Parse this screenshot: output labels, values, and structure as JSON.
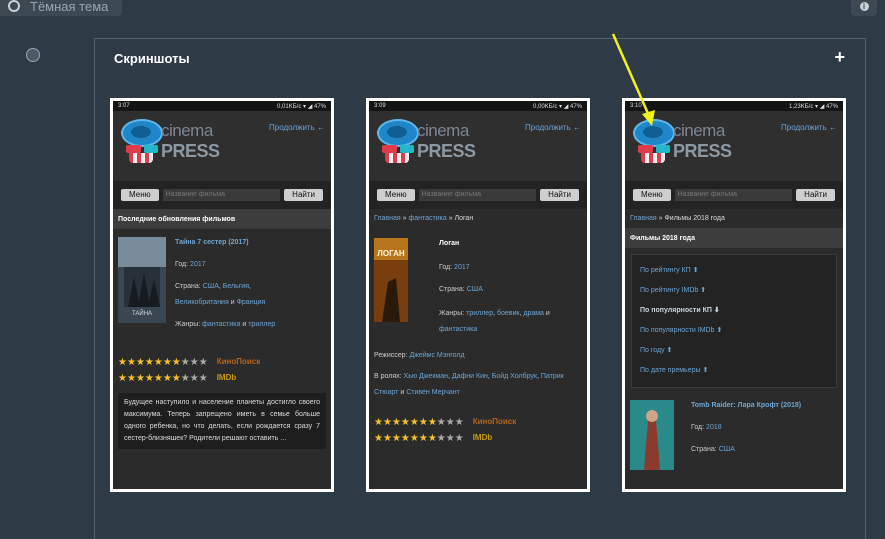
{
  "topbar": {
    "theme_label": "Тёмная тема"
  },
  "panel": {
    "title": "Скриншоты",
    "plus": "+"
  },
  "common": {
    "brand_top": "cinema",
    "brand_bottom": "PRESS",
    "continue": "Продолжить ←",
    "menu": "Меню",
    "search_placeholder": "Название фильма",
    "find": "Найти",
    "kp": "КиноПоиск",
    "imdb": "IMDb"
  },
  "shot1": {
    "time": "3:07",
    "speed": "0,01KБ/с",
    "battery": "47%",
    "section": "Последние обновления фильмов",
    "film_title": "Тайна 7 сестер (2017)",
    "year_label": "Год:",
    "year": "2017",
    "country_label": "Страна:",
    "country1": "США",
    "country2": "Бельгия",
    "country3": "Великобритания",
    "country_and": "и",
    "country4": "Франция",
    "genres_label": "Жанры:",
    "genre1": "фантастика",
    "genre_and": "и",
    "genre2": "триллер",
    "description": "Будущее наступило и население планеты достигло своего максимума. Теперь запрещено иметь в семье больше одного ребенка, но что делать, если рождается сразу 7 сестер-близняшек? Родители решают оставить ..."
  },
  "shot2": {
    "time": "3:09",
    "speed": "0,00KБ/с",
    "battery": "47%",
    "crumb_home": "Главная",
    "crumb_sep": "»",
    "crumb_cat": "фантастика",
    "crumb_sep2": "»",
    "crumb_cur": "Логан",
    "film_title": "Логан",
    "poster_text": "ЛОГАН",
    "year_label": "Год:",
    "year": "2017",
    "country_label": "Страна:",
    "country": "США",
    "genres_label": "Жанры:",
    "genre1": "триллер",
    "genre2": "боевик",
    "genre3": "драма",
    "genre_and": "и",
    "genre4": "фантастика",
    "director_label": "Режиссер:",
    "director": "Джеймс Мэнголд",
    "cast_label": "В ролях:",
    "cast1": "Хью Джекман",
    "cast2": "Дафни Кин",
    "cast3": "Бойд Холбрук",
    "cast4": "Патрик Стюарт",
    "cast_and": "и",
    "cast5": "Стивен Мерчант"
  },
  "shot3": {
    "time": "3:10",
    "speed": "1,23KБ/с",
    "battery": "47%",
    "crumb_home": "Главная",
    "crumb_sep": "»",
    "crumb_cur": "Фильмы 2018 года",
    "section": "Фильмы 2018 года",
    "sort": [
      "По рейтингу КП ⬆",
      "По рейтингу IMDb ⬆",
      "По популярности КП ⬇",
      "По популярности IMDb ⬆",
      "По году ⬆",
      "По дате премьеры ⬆"
    ],
    "film_title": "Tomb Raider: Лара Крофт (2018)",
    "year_label": "Год:",
    "year": "2018",
    "country_label": "Страна:",
    "country": "США"
  },
  "ratings": {
    "kp_stars": 7,
    "imdb_stars": 7,
    "max_stars": 10
  },
  "colors": {
    "kp": "#b5651d",
    "imdb": "#c79a13",
    "link": "#6ea6d6",
    "arrow": "#f2f21a"
  }
}
